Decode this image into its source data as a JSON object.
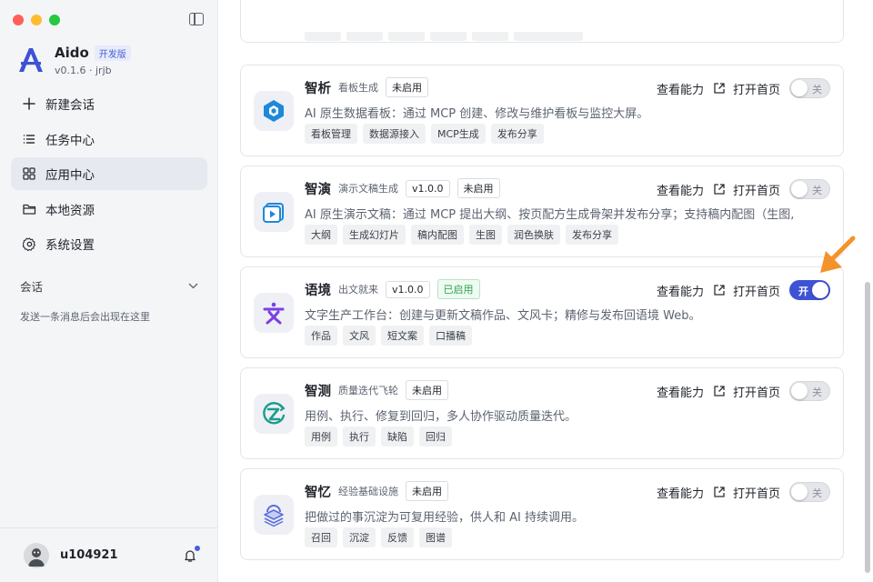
{
  "app": {
    "name": "Aido",
    "badge": "开发版",
    "version": "v0.1.6 · jrjb"
  },
  "nav": [
    {
      "label": "新建会话",
      "icon": "plus-icon"
    },
    {
      "label": "任务中心",
      "icon": "list-icon"
    },
    {
      "label": "应用中心",
      "icon": "grid-icon",
      "active": true
    },
    {
      "label": "本地资源",
      "icon": "folder-icon"
    },
    {
      "label": "系统设置",
      "icon": "gear-icon"
    }
  ],
  "session": {
    "title": "会话",
    "empty": "发送一条消息后会出现在这里"
  },
  "user": {
    "name": "u104921"
  },
  "labels": {
    "view": "查看能力",
    "open": "打开首页",
    "on": "开",
    "off": "关"
  },
  "cards": [
    {
      "name": "智析",
      "subtitle": "看板生成",
      "version": "",
      "status": "未启用",
      "enabled": false,
      "desc": "AI 原生数据看板：通过 MCP 创建、修改与维护看板与监控大屏。",
      "tags": [
        "看板管理",
        "数据源接入",
        "MCP生成",
        "发布分享"
      ]
    },
    {
      "name": "智演",
      "subtitle": "演示文稿生成",
      "version": "v1.0.0",
      "status": "未启用",
      "enabled": false,
      "desc": "AI 原生演示文稿：通过 MCP 提出大纲、按页配方生成骨架并发布分享；支持稿内配图（生图,",
      "tags": [
        "大纲",
        "生成幻灯片",
        "稿内配图",
        "生图",
        "润色换肤",
        "发布分享"
      ]
    },
    {
      "name": "语境",
      "subtitle": "出文就来",
      "version": "v1.0.0",
      "status": "已启用",
      "enabled": true,
      "desc": "文字生产工作台：创建与更新文稿作品、文风卡；精修与发布回语境 Web。",
      "tags": [
        "作品",
        "文风",
        "短文案",
        "口播稿"
      ]
    },
    {
      "name": "智测",
      "subtitle": "质量迭代飞轮",
      "version": "",
      "status": "未启用",
      "enabled": false,
      "desc": "用例、执行、修复到回归，多人协作驱动质量迭代。",
      "tags": [
        "用例",
        "执行",
        "缺陷",
        "回归"
      ]
    },
    {
      "name": "智忆",
      "subtitle": "经验基础设施",
      "version": "",
      "status": "未启用",
      "enabled": false,
      "desc": "把做过的事沉淀为可复用经验，供人和 AI 持续调用。",
      "tags": [
        "召回",
        "沉淀",
        "反馈",
        "图谱"
      ]
    }
  ],
  "colors": {
    "accent": "#3d52d5",
    "enabled_green": "#2da44e",
    "arrow": "#f5922b"
  }
}
